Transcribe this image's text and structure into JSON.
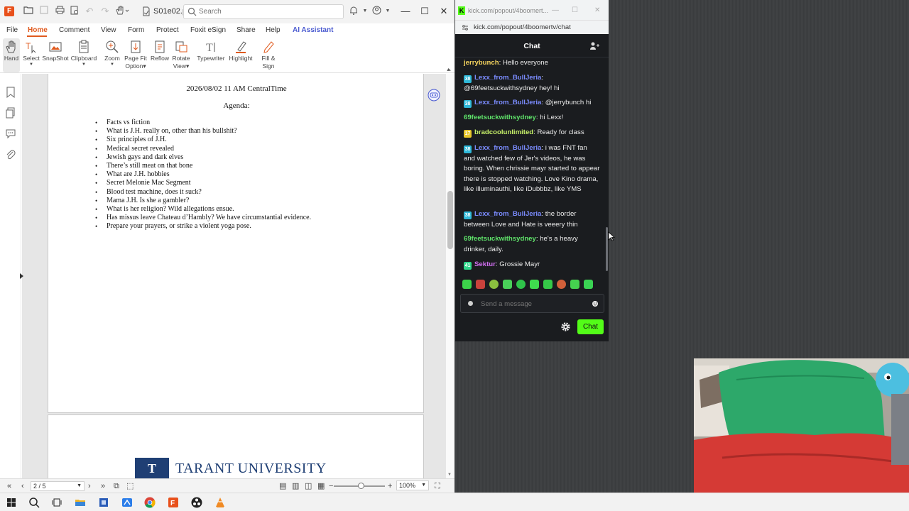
{
  "pdf": {
    "file_name": "S01e02.pdf",
    "search_placeholder": "Search",
    "menu": {
      "file": "File",
      "home": "Home",
      "comment": "Comment",
      "view": "View",
      "form": "Form",
      "protect": "Protect",
      "foxit_esign": "Foxit eSign",
      "share": "Share",
      "help": "Help",
      "ai_assistant": "AI Assistant"
    },
    "ribbon": {
      "hand": "Hand",
      "select": "Select",
      "snapshot": "SnapShot",
      "clipboard": "Clipboard",
      "zoom": "Zoom",
      "page_fit_1": "Page Fit",
      "page_fit_2": "Option",
      "reflow": "Reflow",
      "rotate_1": "Rotate",
      "rotate_2": "View",
      "typewriter": "Typewriter",
      "highlight": "Highlight",
      "fill_sign_1": "Fill &",
      "fill_sign_2": "Sign"
    },
    "document": {
      "date_line": "2026/08/02 11 AM CentralTime",
      "agenda_title": "Agenda:",
      "agenda_items": [
        "Facts vs fiction",
        "What is J.H. really on, other than his bullshit?",
        "Six principles of J.H.",
        "Medical secret revealed",
        "Jewish gays and dark elves",
        "There’s still meat on that bone",
        "What are J.H. hobbies",
        "Secret Melonie Mac Segment",
        "Blood test machine, does it suck?",
        "Mama J.H. Is she a gambler?",
        "What is her religion? Wild allegations ensue.",
        "Has missus leave Chateau d’Hambly? We have circumstantial evidence.",
        "Prepare your prayers, or strike a violent yoga pose."
      ],
      "page2_logo_letter": "T",
      "page2_university": "TARANT UNIVERSITY"
    },
    "status": {
      "page_indicator": "2 / 5",
      "zoom_level": "100%"
    }
  },
  "chat": {
    "window_title": "kick.com/popout/4boomert...",
    "url": "kick.com/popout/4boomertv/chat",
    "header": "Chat",
    "messages": [
      {
        "badge": "",
        "badge_color": "",
        "user": "jerrybunch",
        "user_color": "#f4d35e",
        "text": "Hello everyone"
      },
      {
        "badge": "38",
        "badge_color": "#2fb8d8",
        "user": "Lexx_from_BullJeria",
        "user_color": "#7b8cff",
        "text": "@69feetsuckwithsydney hey! hi"
      },
      {
        "badge": "38",
        "badge_color": "#2fb8d8",
        "user": "Lexx_from_BullJeria",
        "user_color": "#7b8cff",
        "text": "@jerrybunch hi"
      },
      {
        "badge": "",
        "badge_color": "",
        "user": "69feetsuckwithsydney",
        "user_color": "#5fe36a",
        "text": "hi Lexx!"
      },
      {
        "badge": "17",
        "badge_color": "#e8c62a",
        "user": "bradcoolunlimited",
        "user_color": "#c8f26a",
        "text": "Ready for class"
      },
      {
        "badge": "38",
        "badge_color": "#2fb8d8",
        "user": "Lexx_from_BullJeria",
        "user_color": "#7b8cff",
        "text": "i was FNT fan and watched few of Jer's videos, he was boring. When chrissie mayr started to appear there is stopped watching. Love Kino drama, like illuminauthi, like iDubbbz, like YMS"
      },
      {
        "badge": "38",
        "badge_color": "#2fb8d8",
        "user": "Lexx_from_BullJeria",
        "user_color": "#7b8cff",
        "text": "the border between Love and Hate is veeery thin"
      },
      {
        "badge": "",
        "badge_color": "",
        "user": "69feetsuckwithsydney",
        "user_color": "#5fe36a",
        "text": "he's a heavy drinker, daily."
      },
      {
        "badge": "41",
        "badge_color": "#2fd68a",
        "user": "Sektur",
        "user_color": "#d06ef0",
        "text": "Grossie Mayr"
      }
    ],
    "input_placeholder": "Send a message",
    "send_label": "Chat",
    "accent": "#53fc18"
  }
}
